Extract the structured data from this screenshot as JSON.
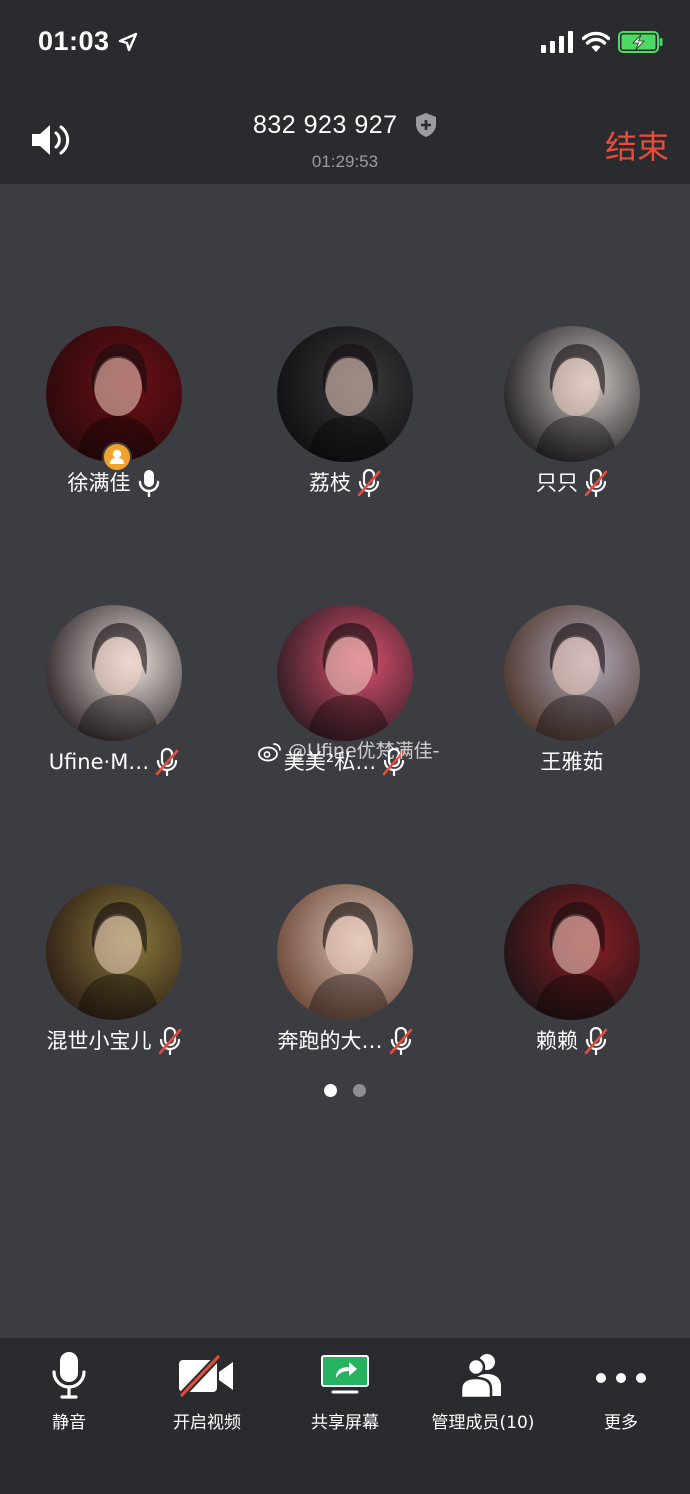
{
  "status_bar": {
    "time": "01:03"
  },
  "header": {
    "meeting_id": "832 923 927",
    "duration": "01:29:53",
    "end_label": "结束"
  },
  "participants": [
    {
      "name": "徐满佳",
      "muted": false,
      "host": true,
      "colors": [
        "#6b0f14",
        "#2a0a0c"
      ]
    },
    {
      "name": "荔枝",
      "muted": true,
      "host": false,
      "colors": [
        "#3a3a3c",
        "#0e0e10"
      ]
    },
    {
      "name": "只只",
      "muted": true,
      "host": false,
      "colors": [
        "#cfc7c4",
        "#1c1a1c"
      ]
    },
    {
      "name": "Ufine·M…",
      "muted": true,
      "host": false,
      "colors": [
        "#e9e3dc",
        "#2a2024"
      ]
    },
    {
      "name": "美美²私…",
      "muted": true,
      "host": false,
      "colors": [
        "#d9506e",
        "#2a1a20"
      ]
    },
    {
      "name": "王雅茹",
      "muted": null,
      "host": false,
      "colors": [
        "#b0a8b8",
        "#4a3328"
      ]
    },
    {
      "name": "混世小宝儿",
      "muted": true,
      "host": false,
      "colors": [
        "#8a7a3c",
        "#2a1c14"
      ]
    },
    {
      "name": "奔跑的大…",
      "muted": true,
      "host": false,
      "colors": [
        "#d8c2b4",
        "#6a4434"
      ]
    },
    {
      "name": "赖赖",
      "muted": true,
      "host": false,
      "colors": [
        "#8a1e24",
        "#1a1416"
      ]
    }
  ],
  "watermark": "@Ufine优梵满佳-",
  "pagination": {
    "current": 1,
    "total": 2
  },
  "toolbar": [
    {
      "label": "静音",
      "icon": "mic-icon"
    },
    {
      "label": "开启视频",
      "icon": "video-off-icon"
    },
    {
      "label": "共享屏幕",
      "icon": "share-screen-icon"
    },
    {
      "label": "管理成员(10)",
      "icon": "members-icon"
    },
    {
      "label": "更多",
      "icon": "more-icon"
    }
  ],
  "colors": {
    "background": "#3b3d42",
    "bar": "#2a2b2e",
    "end_red": "#e74c3c",
    "share_green": "#27b25f",
    "host_badge": "#f0a22c"
  }
}
